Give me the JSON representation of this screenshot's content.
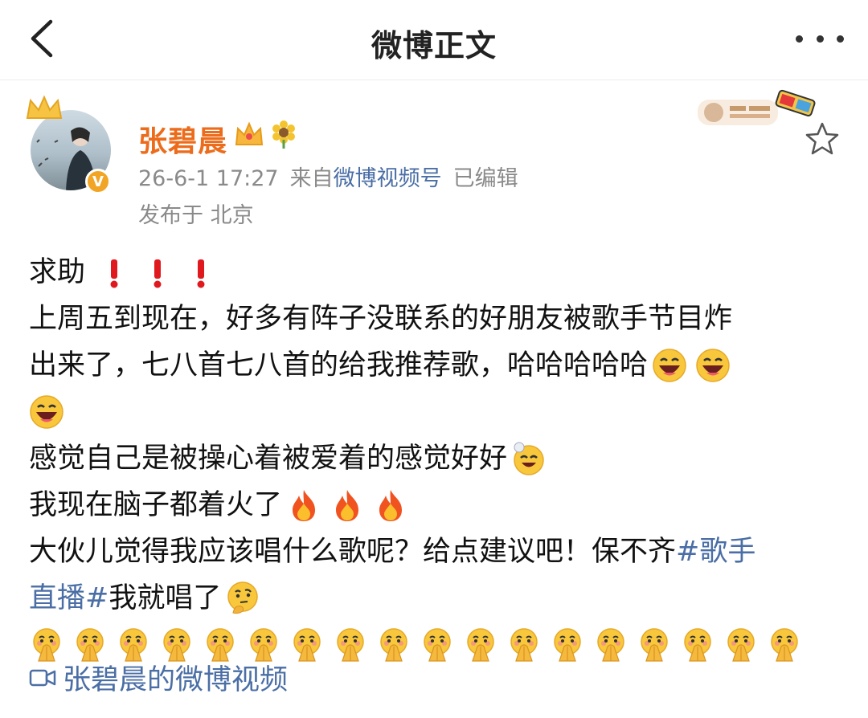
{
  "nav": {
    "title": "微博正文",
    "back_icon": "chevron-left-icon",
    "more_icon": "more-dots-icon"
  },
  "post": {
    "username": "张碧晨",
    "badges": [
      "crown-icon",
      "sunflower-icon"
    ],
    "verified": "V",
    "time": "26-6-1 17:27",
    "source_prefix": "来自",
    "source": "微博视频号",
    "edited": "已编辑",
    "location": "发布于 北京"
  },
  "content": {
    "l1": "求助",
    "l2": "上周五到现在，好多有阵子没联系的好朋友被歌手节目炸",
    "l3": "出来了，七八首七八首的给我推荐歌，哈哈哈哈哈",
    "l5": "感觉自己是被操心着被爱着的感觉好好",
    "l6": "我现在脑子都着火了",
    "l7a": "大伙儿觉得我应该唱什么歌呢？给点建议吧！保不齐",
    "tag_part1": "#歌手",
    "tag_part2": "直播#",
    "l8b": " 我就唱了",
    "pray_count": 18
  },
  "video_link": {
    "label": "张碧晨的微博视频",
    "icon": "video-camera-icon"
  },
  "colors": {
    "username": "#ec6c1c",
    "link": "#4a6ea5",
    "meta": "#8a8a8a",
    "exclaim": "#e0191f"
  }
}
